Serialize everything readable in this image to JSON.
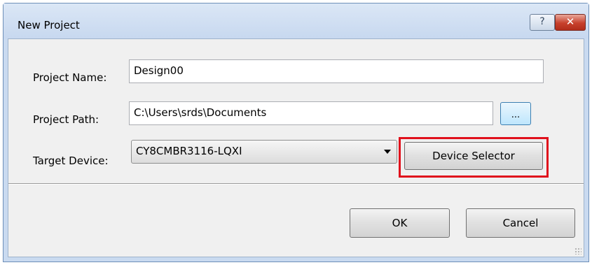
{
  "window": {
    "title": "New Project",
    "help_button": "?",
    "close_button": "✕"
  },
  "form": {
    "project_name": {
      "label": "Project Name:",
      "value": "Design00"
    },
    "project_path": {
      "label": "Project Path:",
      "value": "C:\\Users\\srds\\Documents",
      "browse_label": "..."
    },
    "target_device": {
      "label": "Target Device:",
      "value": "CY8CMBR3116-LQXI",
      "selector_label": "Device Selector"
    }
  },
  "buttons": {
    "ok": "OK",
    "cancel": "Cancel"
  },
  "colors": {
    "highlight": "#e0101c"
  }
}
